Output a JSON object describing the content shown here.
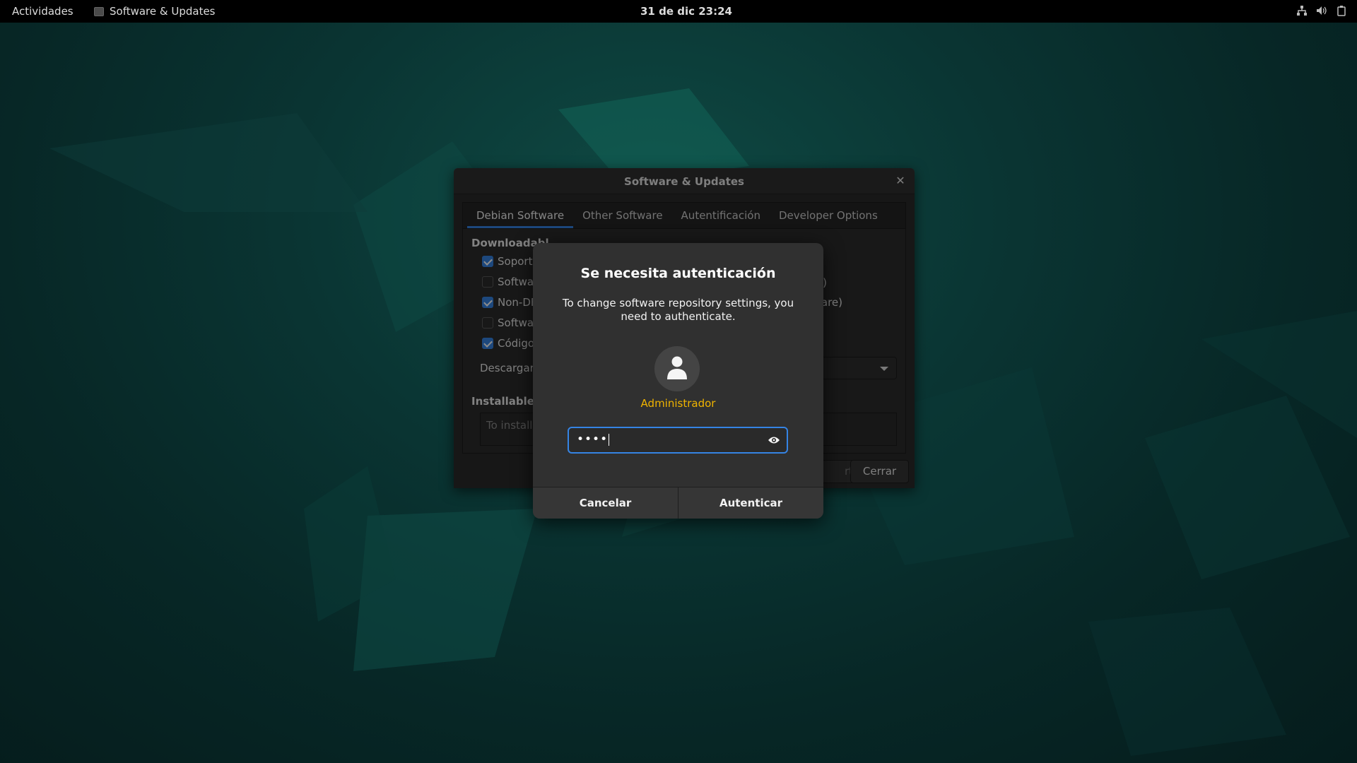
{
  "topbar": {
    "activities": "Actividades",
    "app_name": "Software & Updates",
    "clock": "31 de dic  23:24",
    "tray_icons": [
      "network-icon",
      "volume-icon",
      "power-icon"
    ]
  },
  "window": {
    "title": "Software & Updates",
    "tabs": [
      {
        "label": "Debian Software",
        "active": true
      },
      {
        "label": "Other Software",
        "active": false
      },
      {
        "label": "Autentificación",
        "active": false
      },
      {
        "label": "Developer Options",
        "active": false
      }
    ],
    "section_title": "Downloadabl",
    "checkboxes": [
      {
        "label": "Soporta",
        "checked": true
      },
      {
        "label": "Softwar",
        "checked": false
      },
      {
        "label": "Non-DF",
        "checked": true
      },
      {
        "label": "Softwar",
        "checked": false
      },
      {
        "label": "Código",
        "checked": true
      }
    ],
    "right_fragments": [
      "o)",
      "vare)"
    ],
    "download_label": "Descargar c",
    "installable_title": "Installable fr",
    "textbox_placeholder": "To install f",
    "revert_label": "rt",
    "close_label": "Cerrar"
  },
  "auth": {
    "heading": "Se necesita autenticación",
    "message": "To change software repository settings, you need to authenticate.",
    "username": "Administrador",
    "password_mask": "••••",
    "cancel_label": "Cancelar",
    "authenticate_label": "Autenticar",
    "accent_color": "#3584e4",
    "username_color": "#f0b400"
  }
}
